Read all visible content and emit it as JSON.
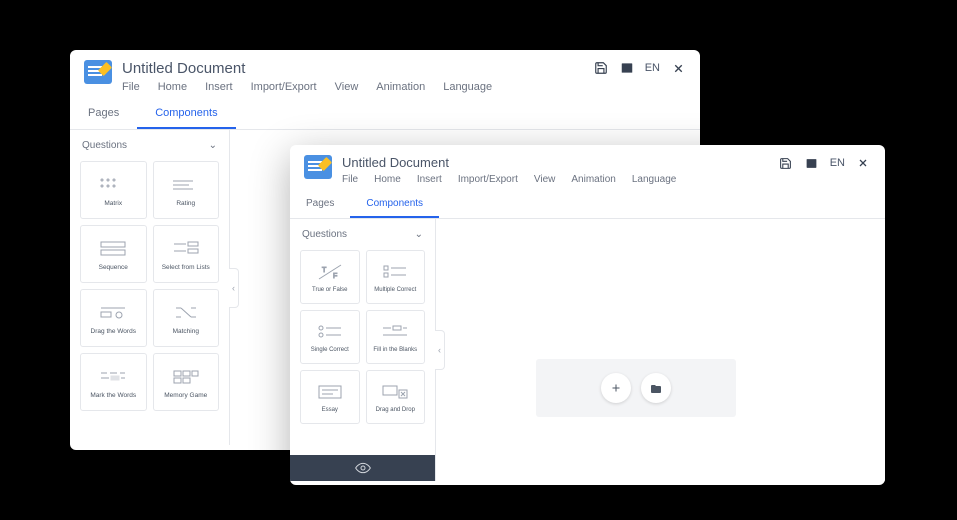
{
  "windowBack": {
    "title": "Untitled Document",
    "menu": {
      "file": "File",
      "home": "Home",
      "insert": "Insert",
      "impexp": "Import/Export",
      "view": "View",
      "animation": "Animation",
      "language": "Language"
    },
    "lang": "EN",
    "tabs": {
      "pages": "Pages",
      "components": "Components"
    },
    "section": "Questions",
    "cards": {
      "c0": "Matrix",
      "c1": "Rating",
      "c2": "Sequence",
      "c3": "Select from Lists",
      "c4": "Drag the Words",
      "c5": "Matching",
      "c6": "Mark the Words",
      "c7": "Memory Game"
    }
  },
  "windowFront": {
    "title": "Untitled Document",
    "menu": {
      "file": "File",
      "home": "Home",
      "insert": "Insert",
      "impexp": "Import/Export",
      "view": "View",
      "animation": "Animation",
      "language": "Language"
    },
    "lang": "EN",
    "tabs": {
      "pages": "Pages",
      "components": "Components"
    },
    "section": "Questions",
    "cards": {
      "c0": "True or False",
      "c1": "Multiple Correct",
      "c2": "Single Correct",
      "c3": "Fill in the Blanks",
      "c4": "Essay",
      "c5": "Drag and Drop"
    }
  }
}
